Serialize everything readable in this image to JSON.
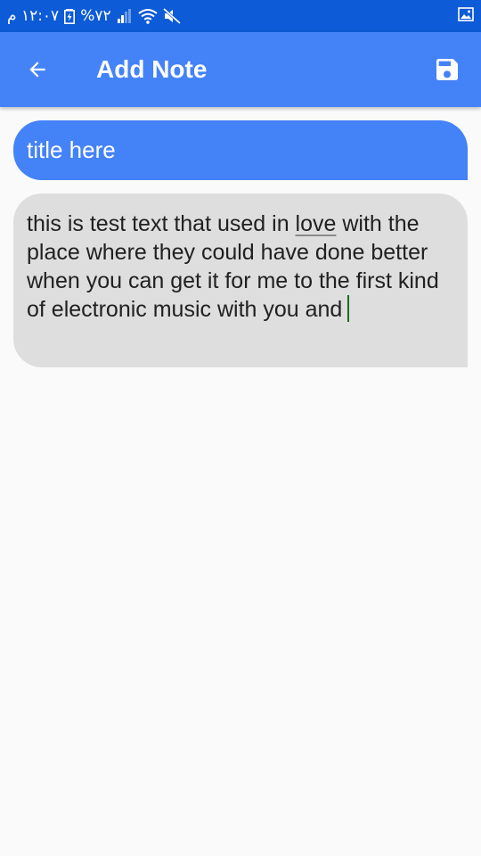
{
  "status_bar": {
    "time": "١٢:٠٧ م",
    "battery_percent": "%٧٢",
    "icons": [
      "battery-charging-icon",
      "signal-icon",
      "wifi-icon",
      "mute-icon",
      "image-notification-icon"
    ]
  },
  "app_bar": {
    "title": "Add Note",
    "back_icon": "arrow-back-icon",
    "save_icon": "save-icon",
    "color": "#4482f7"
  },
  "note": {
    "title_value": "title here",
    "body_before": "this is test text that used in ",
    "body_underlined": "love",
    "body_after": " with the place where they could have done better when you can get it for me to the first kind of electronic music with you and"
  },
  "colors": {
    "status_bar": "#0d5bd6",
    "accent": "#4482f7",
    "body_field": "#dedede",
    "background": "#fafafa"
  }
}
